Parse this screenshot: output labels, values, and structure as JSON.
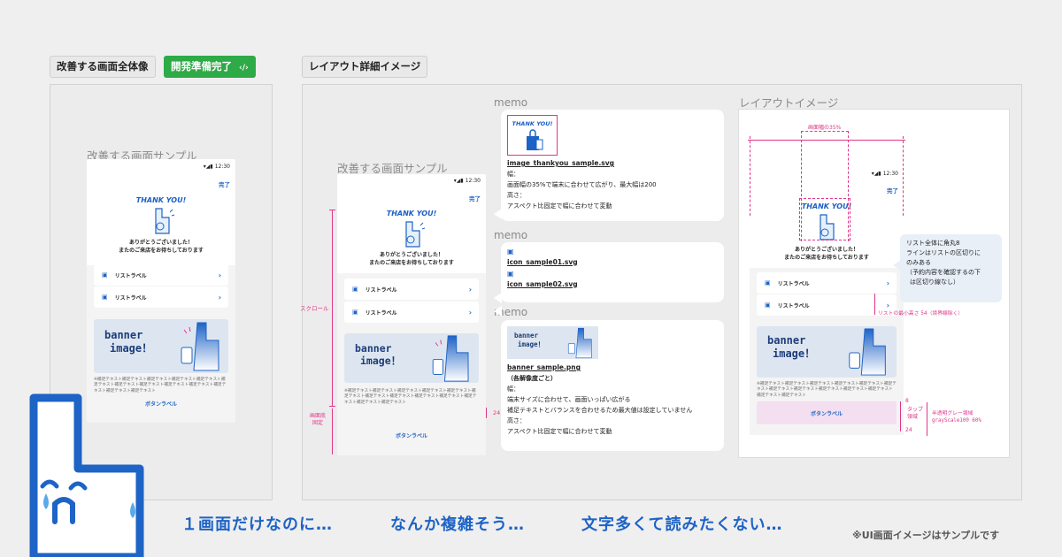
{
  "tags": {
    "overview": "改善する画面全体像",
    "dev_ready": "開発準備完了",
    "dev_ready_icon": "‹/›",
    "layout_detail": "レイアウト詳細イメージ"
  },
  "captions": {
    "sample_left": "改善する画面サンプル",
    "sample_mid": "改善する画面サンプル",
    "layout_image": "レイアウトイメージ"
  },
  "phone": {
    "time": "12:30",
    "done": "完了",
    "thank_you": "THANK YOU!",
    "thanks_line1": "ありがとうございました！",
    "thanks_line2": "またのご来店をお待ちしております",
    "list": [
      {
        "label": "リストラベル",
        "icon": "calendar-icon"
      },
      {
        "label": "リストラベル",
        "icon": "calendar-check-icon"
      }
    ],
    "banner_line1": "banner",
    "banner_line2": "image！",
    "notes": "※補足テキスト補足テキスト補足テキスト補足テキスト補足テキスト補足テキスト補足テキスト補足テキスト補足テキスト補足テキスト補足テキスト補足テキスト補足テキスト",
    "button": "ボタンラベル"
  },
  "annotations": {
    "scroll": "スクロール",
    "fixed_line1": "画面底",
    "fixed_line2": "固定",
    "gap_24": "24",
    "width_35": "画面幅の35%",
    "list_min_height": "リストの最小高さ 54（境界線除く）",
    "tap_area_line1": "タップ",
    "tap_area_line2": "領域",
    "gap_8": "8",
    "gap_24b": "24",
    "overlay_line1": "半透明グレー領域",
    "overlay_line2": "grayScale100 60%"
  },
  "memos": {
    "label": "memo",
    "memo1": {
      "thumb": "THANK YOU!",
      "file": "image_thankyou_sample.svg",
      "l1": "幅：",
      "l2": "画面幅の35%で端末に合わせて広がり、最大幅は200",
      "l3": "高さ：",
      "l4": "アスペクト比固定で幅に合わせて変動"
    },
    "memo2": {
      "file1": "icon_sample01.svg",
      "file2": "icon_sample02.svg"
    },
    "memo3": {
      "thumb1": "banner",
      "thumb2": "image！",
      "file": "banner_sample.png",
      "sub": "（各解像度ごと）",
      "l1": "幅：",
      "l2": "端末サイズに合わせて、画面いっぱい広がる",
      "l3": "補足テキストとバランスを合わせるため最大値は設定していません",
      "l4": "高さ：",
      "l5": "アスペクト比固定で幅に合わせて変動"
    }
  },
  "bubble": {
    "l1": "リスト全体に角丸8",
    "l2": "ラインはリストの区切りに",
    "l3": "のみある",
    "l4": "（予約内容を確認するの下",
    "l5": "は区切り線なし）"
  },
  "bottom": {
    "t1": "１画面だけなのに…",
    "t2": "なんか複雑そう…",
    "t3": "文字多くて読みたくない…",
    "disclaimer": "※UI画面イメージはサンプルです"
  },
  "colors": {
    "accent_blue": "#1e63c6",
    "dev_green": "#2eaa47",
    "annotation_pink": "#e0358a"
  }
}
